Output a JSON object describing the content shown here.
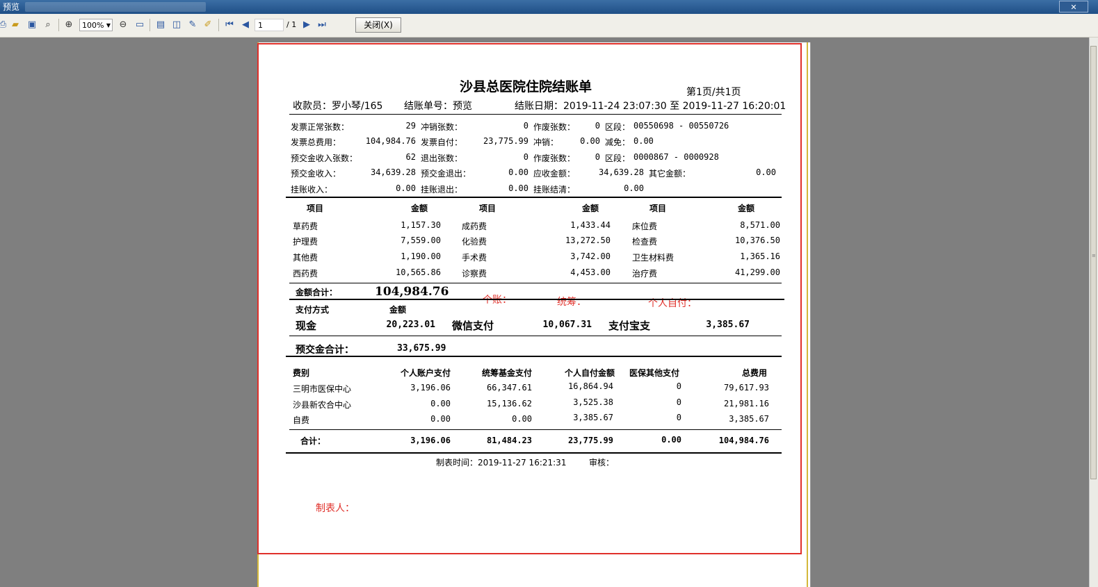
{
  "window": {
    "title": "预览"
  },
  "toolbar": {
    "zoom": "100%",
    "page_input": "1",
    "page_total": "/ 1",
    "close_label": "关闭(X)"
  },
  "report": {
    "title": "沙县总医院住院结账单",
    "page_info": "第1页/共1页",
    "cashier": "收款员：罗小琴/165",
    "bill_no": "结账单号：预览",
    "date_range": "结账日期：2019-11-24 23:07:30 至 2019-11-27 16:20:01",
    "summary": [
      [
        {
          "label": "发票正常张数：",
          "value": "29"
        },
        {
          "label": "冲销张数：",
          "value": "0"
        },
        {
          "label": "作废张数：",
          "value": "0"
        },
        {
          "label": "区段：",
          "value": "00550698 - 00550726"
        }
      ],
      [
        {
          "label": "发票总费用：",
          "value": "104,984.76"
        },
        {
          "label": "发票自付：",
          "value": "23,775.99"
        },
        {
          "label": "冲销：",
          "value": "0.00"
        },
        {
          "label": "减免：",
          "value": "0.00"
        }
      ],
      [
        {
          "label": "预交金收入张数：",
          "value": "62"
        },
        {
          "label": "退出张数：",
          "value": "0"
        },
        {
          "label": "作废张数：",
          "value": "0"
        },
        {
          "label": "区段：",
          "value": "0000867 - 0000928"
        }
      ],
      [
        {
          "label": "预交金收入：",
          "value": "34,639.28"
        },
        {
          "label": "预交金退出：",
          "value": "0.00"
        },
        {
          "label": "应收金额：",
          "value": "34,639.28"
        },
        {
          "label": "其它金额：",
          "value": "0.00"
        }
      ],
      [
        {
          "label": "挂账收入：",
          "value": "0.00"
        },
        {
          "label": "挂账退出：",
          "value": "0.00"
        },
        {
          "label": "挂账结清：",
          "value": "0.00"
        }
      ]
    ],
    "items_header": {
      "item": "项目",
      "amount": "金额"
    },
    "items": [
      [
        {
          "name": "草药费",
          "amount": "1,157.30"
        },
        {
          "name": "成药费",
          "amount": "1,433.44"
        },
        {
          "name": "床位费",
          "amount": "8,571.00"
        }
      ],
      [
        {
          "name": "护理费",
          "amount": "7,559.00"
        },
        {
          "name": "化验费",
          "amount": "13,272.50"
        },
        {
          "name": "检查费",
          "amount": "10,376.50"
        }
      ],
      [
        {
          "name": "其他费",
          "amount": "1,190.00"
        },
        {
          "name": "手术费",
          "amount": "3,742.00"
        },
        {
          "name": "卫生材料费",
          "amount": "1,365.16"
        }
      ],
      [
        {
          "name": "西药费",
          "amount": "10,565.86"
        },
        {
          "name": "诊察费",
          "amount": "4,453.00"
        },
        {
          "name": "治疗费",
          "amount": "41,299.00"
        }
      ]
    ],
    "total_label": "金额合计：",
    "total_value": "104,984.76",
    "annotations": {
      "personal_account": "个账：",
      "pooled": "统筹：",
      "self_pay": "个人自付：",
      "preparer": "制表人："
    },
    "payment": {
      "method_header": "支付方式",
      "amount_header": "金额",
      "methods": [
        {
          "name": "现金",
          "amount": "20,223.01"
        },
        {
          "name": "微信支付",
          "amount": "10,067.31"
        },
        {
          "name": "支付宝支",
          "amount": "3,385.67"
        }
      ]
    },
    "deposit_total_label": "预交金合计：",
    "deposit_total_value": "33,675.99",
    "insurance": {
      "headers": [
        "费别",
        "个人账户支付",
        "统筹基金支付",
        "个人自付金额",
        "医保其他支付",
        "总费用"
      ],
      "rows": [
        [
          "三明市医保中心",
          "3,196.06",
          "66,347.61",
          "16,864.94",
          "0",
          "79,617.93"
        ],
        [
          "沙县新农合中心",
          "0.00",
          "15,136.62",
          "3,525.38",
          "0",
          "21,981.16"
        ],
        [
          "自费",
          "0.00",
          "0.00",
          "3,385.67",
          "0",
          "3,385.67"
        ]
      ],
      "totals": [
        "合计：",
        "3,196.06",
        "81,484.23",
        "23,775.99",
        "0.00",
        "104,984.76"
      ]
    },
    "footer": {
      "made_time": "制表时间：2019-11-27 16:21:31",
      "review": "审核："
    }
  },
  "colors": {
    "annotation_red": "#e0302a",
    "titlebar": "#1f4f86"
  }
}
